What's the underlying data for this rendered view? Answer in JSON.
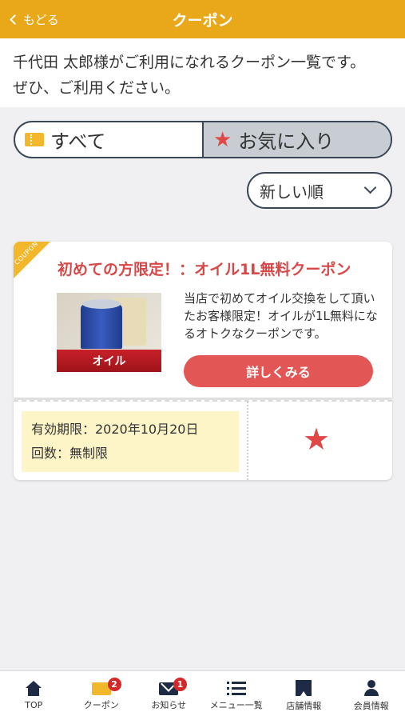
{
  "header": {
    "back_label": "もどる",
    "title": "クーポン",
    "color": "#e8a81a"
  },
  "intro": {
    "line1": "千代田 太郎様がご利用になれるクーポン一覧です。",
    "line2": "ぜひ、ご利用ください。"
  },
  "tabs": [
    {
      "label": "すべて",
      "icon": "ticket-icon",
      "selected": true
    },
    {
      "label": "お気に入り",
      "icon": "star-icon",
      "selected": false
    }
  ],
  "sort": {
    "selected": "新しい順"
  },
  "coupon": {
    "corner_label": "COUPON",
    "title": "初めての方限定！：オイル1L無料クーポン",
    "image_label": "オイル",
    "description": "当店で初めてオイル交換をして頂いたお客様限定！オイルが1L無料になるオトクなクーポンです。",
    "detail_button": "詳しくみる",
    "validity_line": "有効期限：2020年10月20日",
    "count_line": "回数：無制限",
    "favorite": true
  },
  "nav": {
    "items": [
      {
        "label": "TOP",
        "icon": "home-icon"
      },
      {
        "label": "クーポン",
        "icon": "coupon-icon",
        "badge": "2"
      },
      {
        "label": "お知らせ",
        "icon": "mail-icon",
        "badge": "1"
      },
      {
        "label": "メニュー一覧",
        "icon": "menu-icon"
      },
      {
        "label": "店舗情報",
        "icon": "store-icon"
      },
      {
        "label": "会員情報",
        "icon": "member-icon"
      }
    ]
  },
  "colors": {
    "accent": "#e8a81a",
    "button": "#e25656",
    "star": "#e04848",
    "navy": "#1d2b45"
  }
}
